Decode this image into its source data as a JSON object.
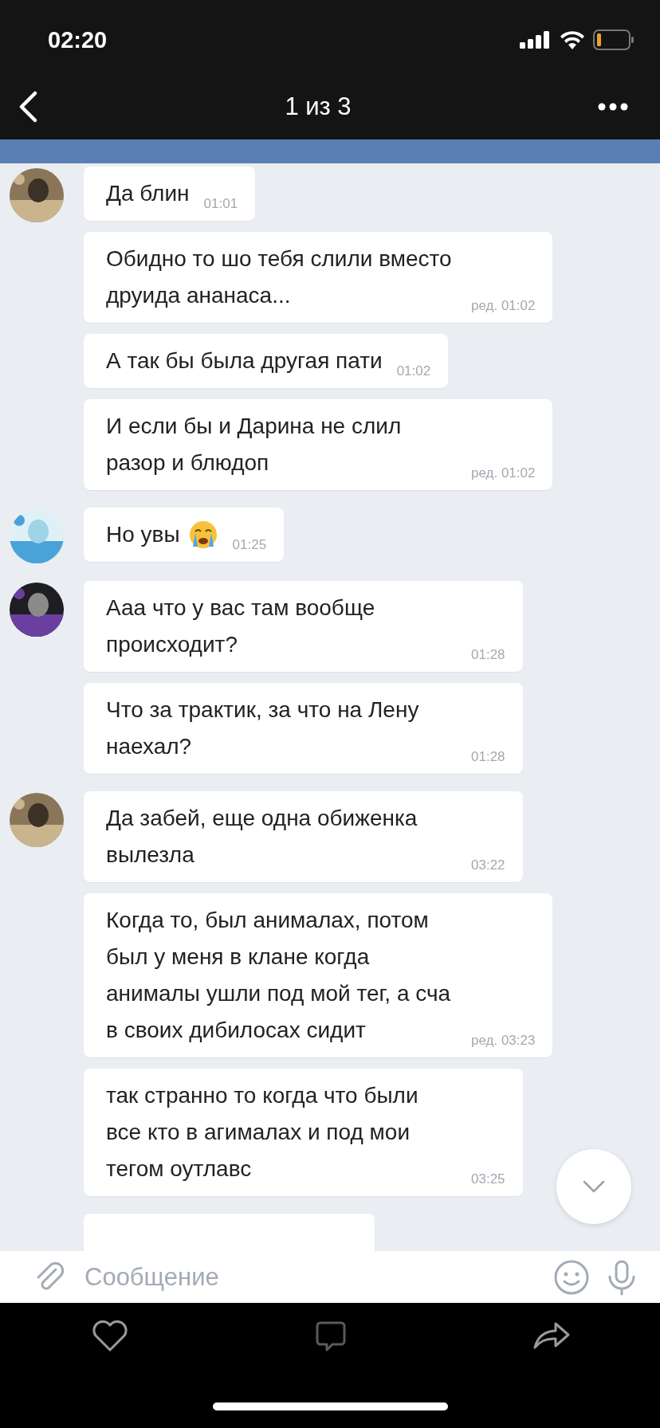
{
  "status_bar": {
    "time": "02:20"
  },
  "header": {
    "title": "1 из 3"
  },
  "chat": {
    "groups": [
      {
        "avatar": {
          "kind": "picture"
        },
        "messages": [
          {
            "text": "Да блин",
            "time": "01:01",
            "emoji": false
          },
          {
            "text": "Обидно то шо тебя слили вместо друида ананаса...",
            "time": "ред. 01:02",
            "emoji": false
          },
          {
            "text": "А так бы была другая пати",
            "time": "01:02",
            "emoji": false
          },
          {
            "text": "И если бы и Дарина не слил разор и блюдоп",
            "time": "ред. 01:02",
            "emoji": false
          }
        ]
      },
      {
        "avatar": {
          "kind": "picture"
        },
        "messages": [
          {
            "text": "Но увы",
            "time": "01:25",
            "emoji": true
          }
        ]
      },
      {
        "avatar": {
          "kind": "picture"
        },
        "messages": [
          {
            "text": "Ааа что у вас там вообще происходит?",
            "time": "01:28",
            "emoji": false
          },
          {
            "text": "Что за трактик, за что на Лену наехал?",
            "time": "01:28",
            "emoji": false
          }
        ]
      },
      {
        "avatar": {
          "kind": "picture"
        },
        "messages": [
          {
            "text": "Да забей, еще одна обиженка вылезла",
            "time": "03:22",
            "emoji": false
          },
          {
            "text": "Когда то, был анималах, потом был у меня в клане когда анималы ушли под мой тег,  а сча в своих дибилосах сидит",
            "time": "ред. 03:23",
            "emoji": false
          },
          {
            "text": "так странно то когда что были все кто в агималах и под мои тегом оутлавс",
            "time": "03:25",
            "emoji": false
          }
        ]
      }
    ]
  },
  "composer": {
    "placeholder": "Сообщение"
  }
}
